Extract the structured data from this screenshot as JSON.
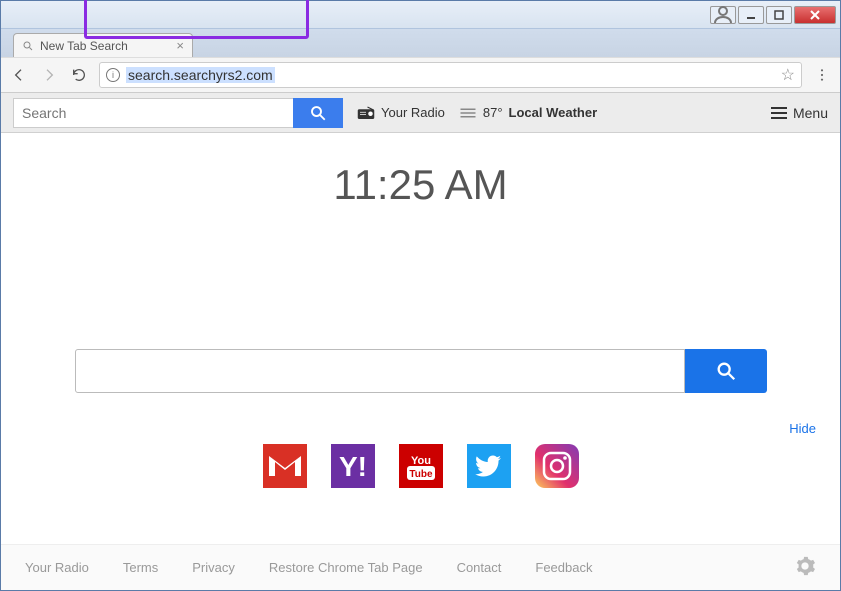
{
  "window": {
    "tab_title": "New Tab Search",
    "url": "search.searchyrs2.com"
  },
  "toolbar": {
    "search_placeholder": "Search",
    "radio_label": "Your Radio",
    "temp": "87°",
    "weather_label": "Local Weather",
    "menu_label": "Menu"
  },
  "content": {
    "time": "11:25 AM",
    "hide_label": "Hide"
  },
  "apps": {
    "gmail": "Gmail",
    "yahoo": "Yahoo",
    "youtube": "YouTube",
    "twitter": "Twitter",
    "instagram": "Instagram"
  },
  "footer": {
    "radio": "Your Radio",
    "terms": "Terms",
    "privacy": "Privacy",
    "restore": "Restore Chrome Tab Page",
    "contact": "Contact",
    "feedback": "Feedback"
  }
}
